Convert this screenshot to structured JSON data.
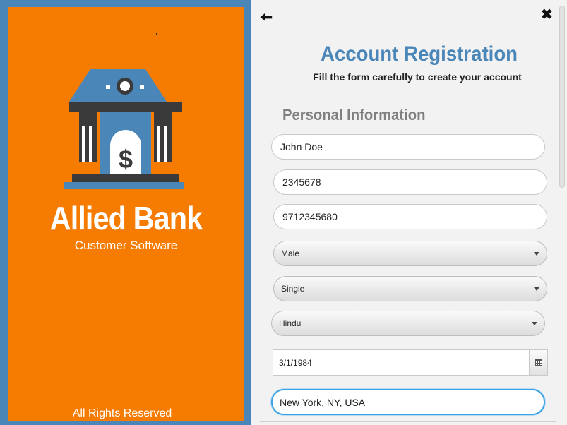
{
  "brand": {
    "name": "Allied Bank",
    "tagline": "Customer Software",
    "footer": "All Rights Reserved",
    "panel_color": "#f57c00",
    "logo_icon": "bank-building-dollar-icon"
  },
  "header": {
    "back_icon": "arrow-left-icon",
    "close_icon": "close-icon",
    "title": "Account Registration",
    "subtitle": "Fill the form carefully to create your account",
    "accent": "#4a86b8"
  },
  "form": {
    "section_title": "Personal Information",
    "name": "John Doe",
    "phone": "2345678",
    "mobile": "9712345680",
    "gender": "Male",
    "marital_status": "Single",
    "religion": "Hindu",
    "dob": "3/1/1984",
    "address": "New York, NY, USA"
  }
}
